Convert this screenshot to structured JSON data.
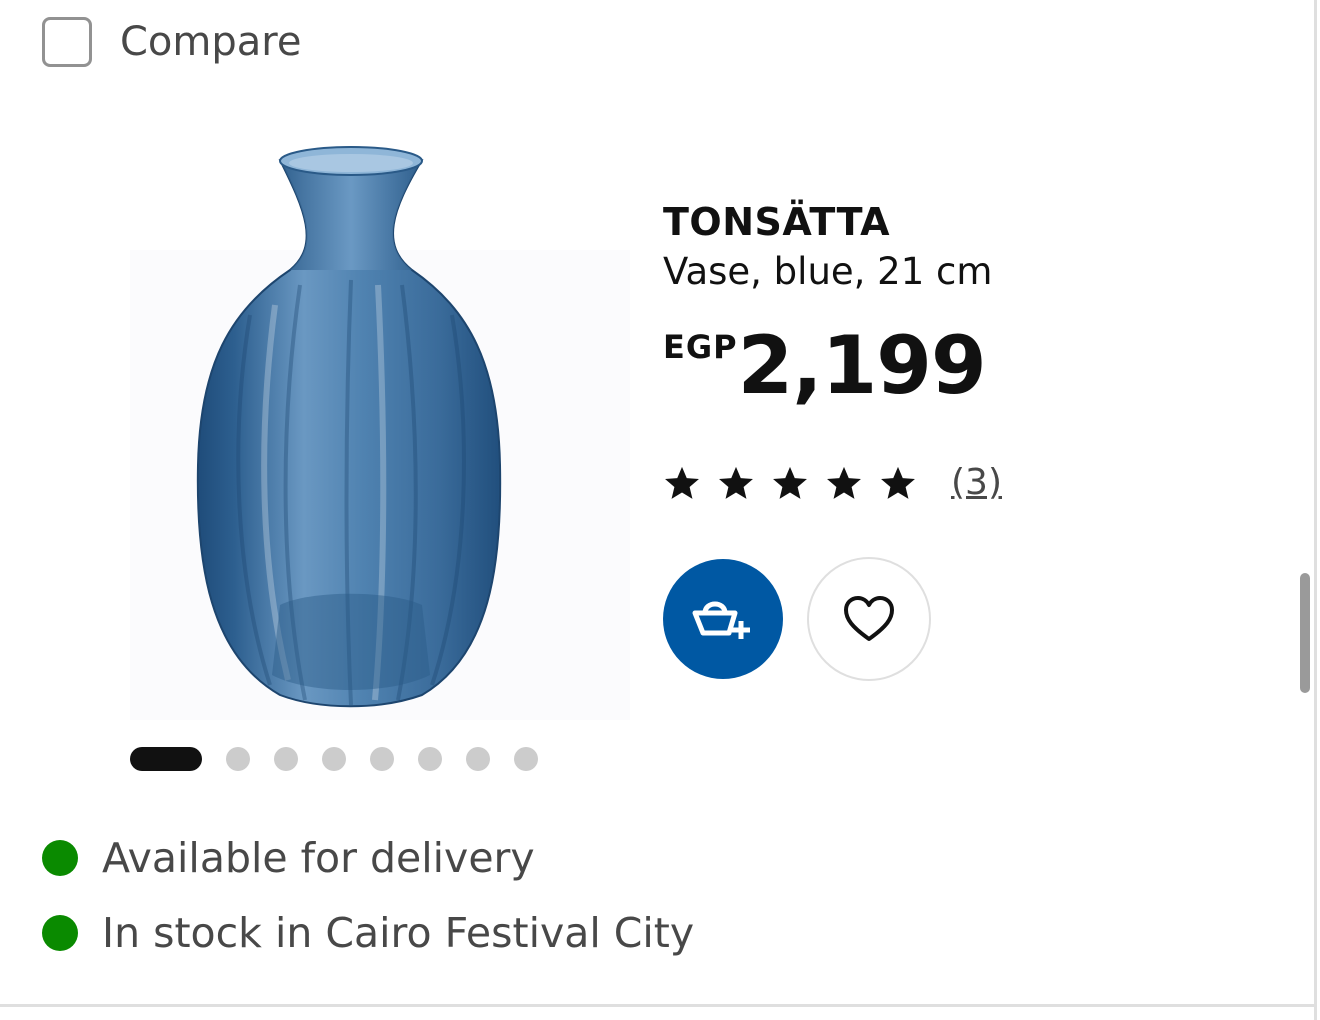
{
  "compare": {
    "label": "Compare",
    "checked": false
  },
  "product": {
    "name": "TONSÄTTA",
    "description": "Vase, blue, 21 cm",
    "price": {
      "currency": "EGP",
      "amount": "2,199"
    },
    "rating": {
      "stars": 5,
      "max_stars": 5,
      "review_count": "(3)"
    }
  },
  "gallery": {
    "total_images": 8,
    "active_index": 0
  },
  "actions": {
    "add_to_cart_icon": "add-to-basket-icon",
    "favourite_icon": "heart-icon"
  },
  "availability": [
    {
      "text": "Available for delivery",
      "status_color": "#0a8a00"
    },
    {
      "text": "In stock in Cairo Festival City",
      "status_color": "#0a8a00"
    }
  ],
  "colors": {
    "brand_blue": "#0058a3",
    "available_green": "#0a8a00",
    "vase_blue": "#3a6f9e"
  }
}
